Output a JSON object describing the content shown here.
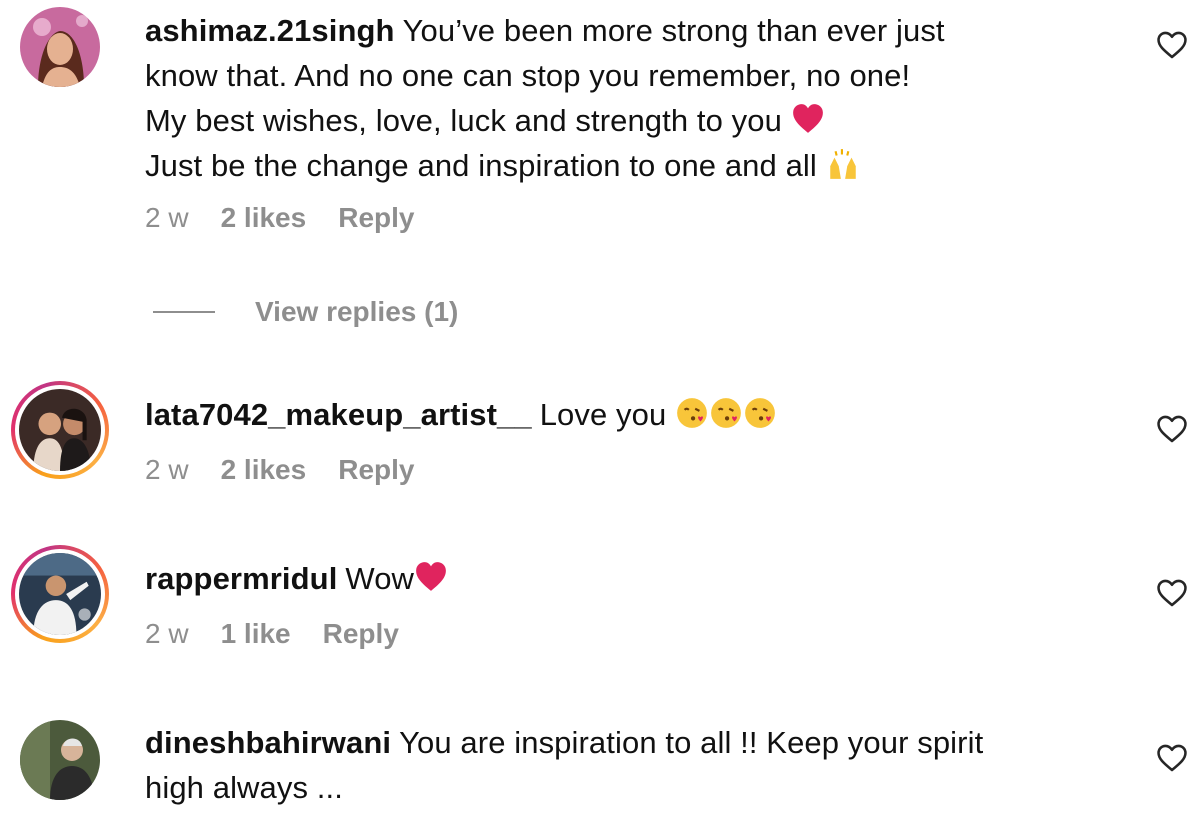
{
  "comments": [
    {
      "username": "ashimaz.21singh",
      "lines": [
        "You’ve been more strong than ever just",
        "know that. And no one can stop you remember, no one!",
        "My best wishes, love, luck and strength to you",
        "Just be the change and inspiration to one and all"
      ],
      "time": "2 w",
      "likes": "2 likes",
      "reply": "Reply",
      "avatar_icon": "user-avatar",
      "emoji_icons": [
        "red-heart-emoji",
        "raising-hands-emoji"
      ]
    },
    {
      "username": "lata7042_makeup_artist__",
      "text": "Love you",
      "time": "2 w",
      "likes": "2 likes",
      "reply": "Reply",
      "avatar_icon": "user-avatar",
      "emoji_icons": [
        "kissing-face-emoji",
        "kissing-face-emoji",
        "kissing-face-emoji"
      ]
    },
    {
      "username": "rappermridul",
      "text": "Wow",
      "time": "2 w",
      "likes": "1 like",
      "reply": "Reply",
      "avatar_icon": "user-avatar",
      "emoji_icons": [
        "red-heart-emoji"
      ]
    },
    {
      "username": "dineshbahirwani",
      "lines": [
        "You are inspiration to all !! Keep your spirit",
        "high always ..."
      ],
      "avatar_icon": "user-avatar"
    }
  ],
  "view_replies": "View replies (1)",
  "like_icon": "heart-outline-icon",
  "colors": {
    "text": "#111111",
    "secondary": "#8e8e8e",
    "story_ring_start": "#f9a11b",
    "story_ring_end": "#c13584",
    "heart": "#e0245e"
  }
}
